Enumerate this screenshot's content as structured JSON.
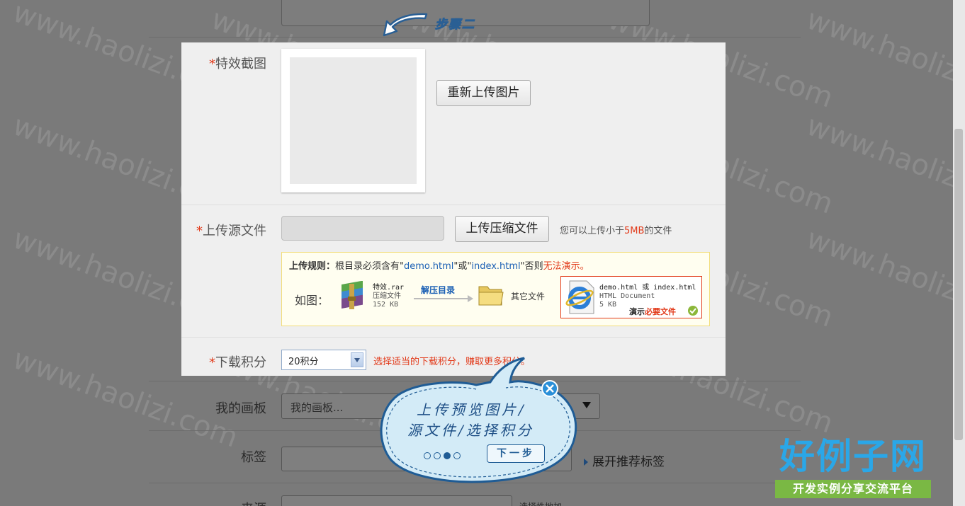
{
  "watermark": "www.haolizi.com",
  "step_label": "步骤二",
  "background_form": {
    "my_board_label": "我的画板",
    "my_board_placeholder": "我的画板...",
    "tags_label": "标签",
    "expand_tags": "展开推荐标签",
    "source_label": "来源",
    "source_hint": "选择性地加"
  },
  "form": {
    "required_mark": "*",
    "screenshot": {
      "label": "特效截图",
      "reupload_button": "重新上传图片"
    },
    "source_file": {
      "label": "上传源文件",
      "upload_button": "上传压缩文件",
      "hint_prefix": "您可以上传小于",
      "hint_size": "5MB",
      "hint_suffix": "的文件"
    },
    "rules": {
      "title": "上传规则：",
      "text1": "根目录必须含有\"",
      "demo_html": "demo.html",
      "text2": "\"或\"",
      "index_html": "index.html",
      "text3": "\"否则",
      "cannot_demo": "无法演示。",
      "example_label": "如图：",
      "rar_name": "特效.rar",
      "rar_type": "压缩文件",
      "rar_size": "152 KB",
      "extract_label": "解压目录",
      "other_files": "其它文件",
      "demo_file_name": "demo.html 或 index.html",
      "demo_file_type": "HTML Document",
      "demo_file_size": "5 KB",
      "demo_required_prefix": "演示",
      "demo_required_suffix": "必要文件"
    },
    "points": {
      "label": "下载积分",
      "selected": "20积分",
      "hint": "选择适当的下载积分，赚取更多积分。"
    }
  },
  "tour_bubble": {
    "line1": "上传预览图片/",
    "line2": "源文件/选择积分",
    "next_button": "下一步",
    "current_step": 3,
    "total_steps": 4
  },
  "logo": {
    "title": "好例子网",
    "subtitle": "开发实例分享交流平台"
  },
  "colors": {
    "required": "#e23a1a",
    "link_blue": "#1a5fb4",
    "bubble_fill": "#d3ebf7",
    "logo_blue": "#2aa7e8",
    "logo_green": "#7ab844"
  }
}
